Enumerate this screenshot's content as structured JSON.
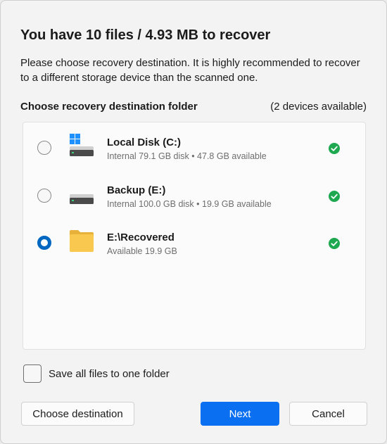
{
  "dialog": {
    "title": "You have 10 files / 4.93 MB to recover",
    "description": "Please choose recovery destination. It is highly recommended to recover to a different storage device than the scanned one.",
    "section_label": "Choose recovery destination folder",
    "section_count": "(2 devices available)"
  },
  "destinations": [
    {
      "name": "Local Disk (C:)",
      "detail": "Internal 79.1 GB disk • 47.8 GB available",
      "icon": "windows-drive-icon",
      "selected": false,
      "available": true
    },
    {
      "name": "Backup (E:)",
      "detail": "Internal 100.0 GB disk • 19.9 GB available",
      "icon": "drive-icon",
      "selected": false,
      "available": true
    },
    {
      "name": "E:\\Recovered",
      "detail": "Available 19.9 GB",
      "icon": "folder-icon",
      "selected": true,
      "available": true
    }
  ],
  "options": {
    "save_one_folder_label": "Save all files to one folder",
    "save_one_folder_checked": false
  },
  "buttons": {
    "choose_destination": "Choose destination",
    "next": "Next",
    "cancel": "Cancel"
  },
  "colors": {
    "accent": "#0a6ff0",
    "success": "#1ea84f",
    "folder": "#f8c94e"
  }
}
